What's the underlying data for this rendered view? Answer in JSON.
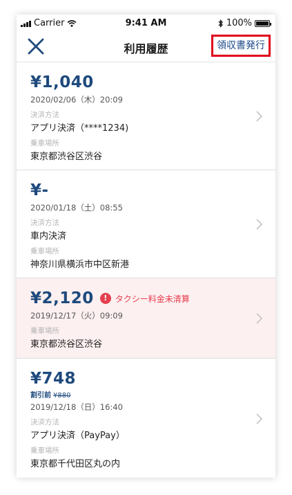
{
  "status_bar": {
    "carrier": "Carrier",
    "time": "9:41 AM",
    "battery": "100%"
  },
  "nav": {
    "title": "利用履歴",
    "receipt_button": "領収書発行"
  },
  "labels": {
    "payment_method": "決済方法",
    "pickup_location": "乗車場所"
  },
  "items": [
    {
      "amount": "¥1,040",
      "date": "2020/02/06（木）20:09",
      "payment": "アプリ決済（****1234)",
      "location": "東京都渋谷区渋谷"
    },
    {
      "amount": "¥-",
      "date": "2020/01/18（土）08:55",
      "payment": "車内決済",
      "location": "神奈川県横浜市中区新港"
    },
    {
      "amount": "¥2,120",
      "warning": "タクシー料金未清算",
      "date": "2019/12/17（火）09:09",
      "location": "東京都渋谷区渋谷"
    },
    {
      "amount": "¥748",
      "discount_label": "割引前",
      "discount_original": "¥880",
      "date": "2019/12/18（日）16:40",
      "payment": "アプリ決済（PayPay）",
      "location": "東京都千代田区丸の内"
    }
  ],
  "colors": {
    "accent": "#1e4a7d",
    "highlight_border": "#e0001b",
    "warning": "#e6404e",
    "alert_bg": "#fdf0f1"
  },
  "icons": {
    "close": "close-icon",
    "chevron": "chevron-right-icon",
    "warning": "exclamation-circle-icon",
    "wifi": "wifi-icon",
    "bluetooth": "bluetooth-icon",
    "battery": "battery-icon",
    "signal": "signal-icon"
  }
}
